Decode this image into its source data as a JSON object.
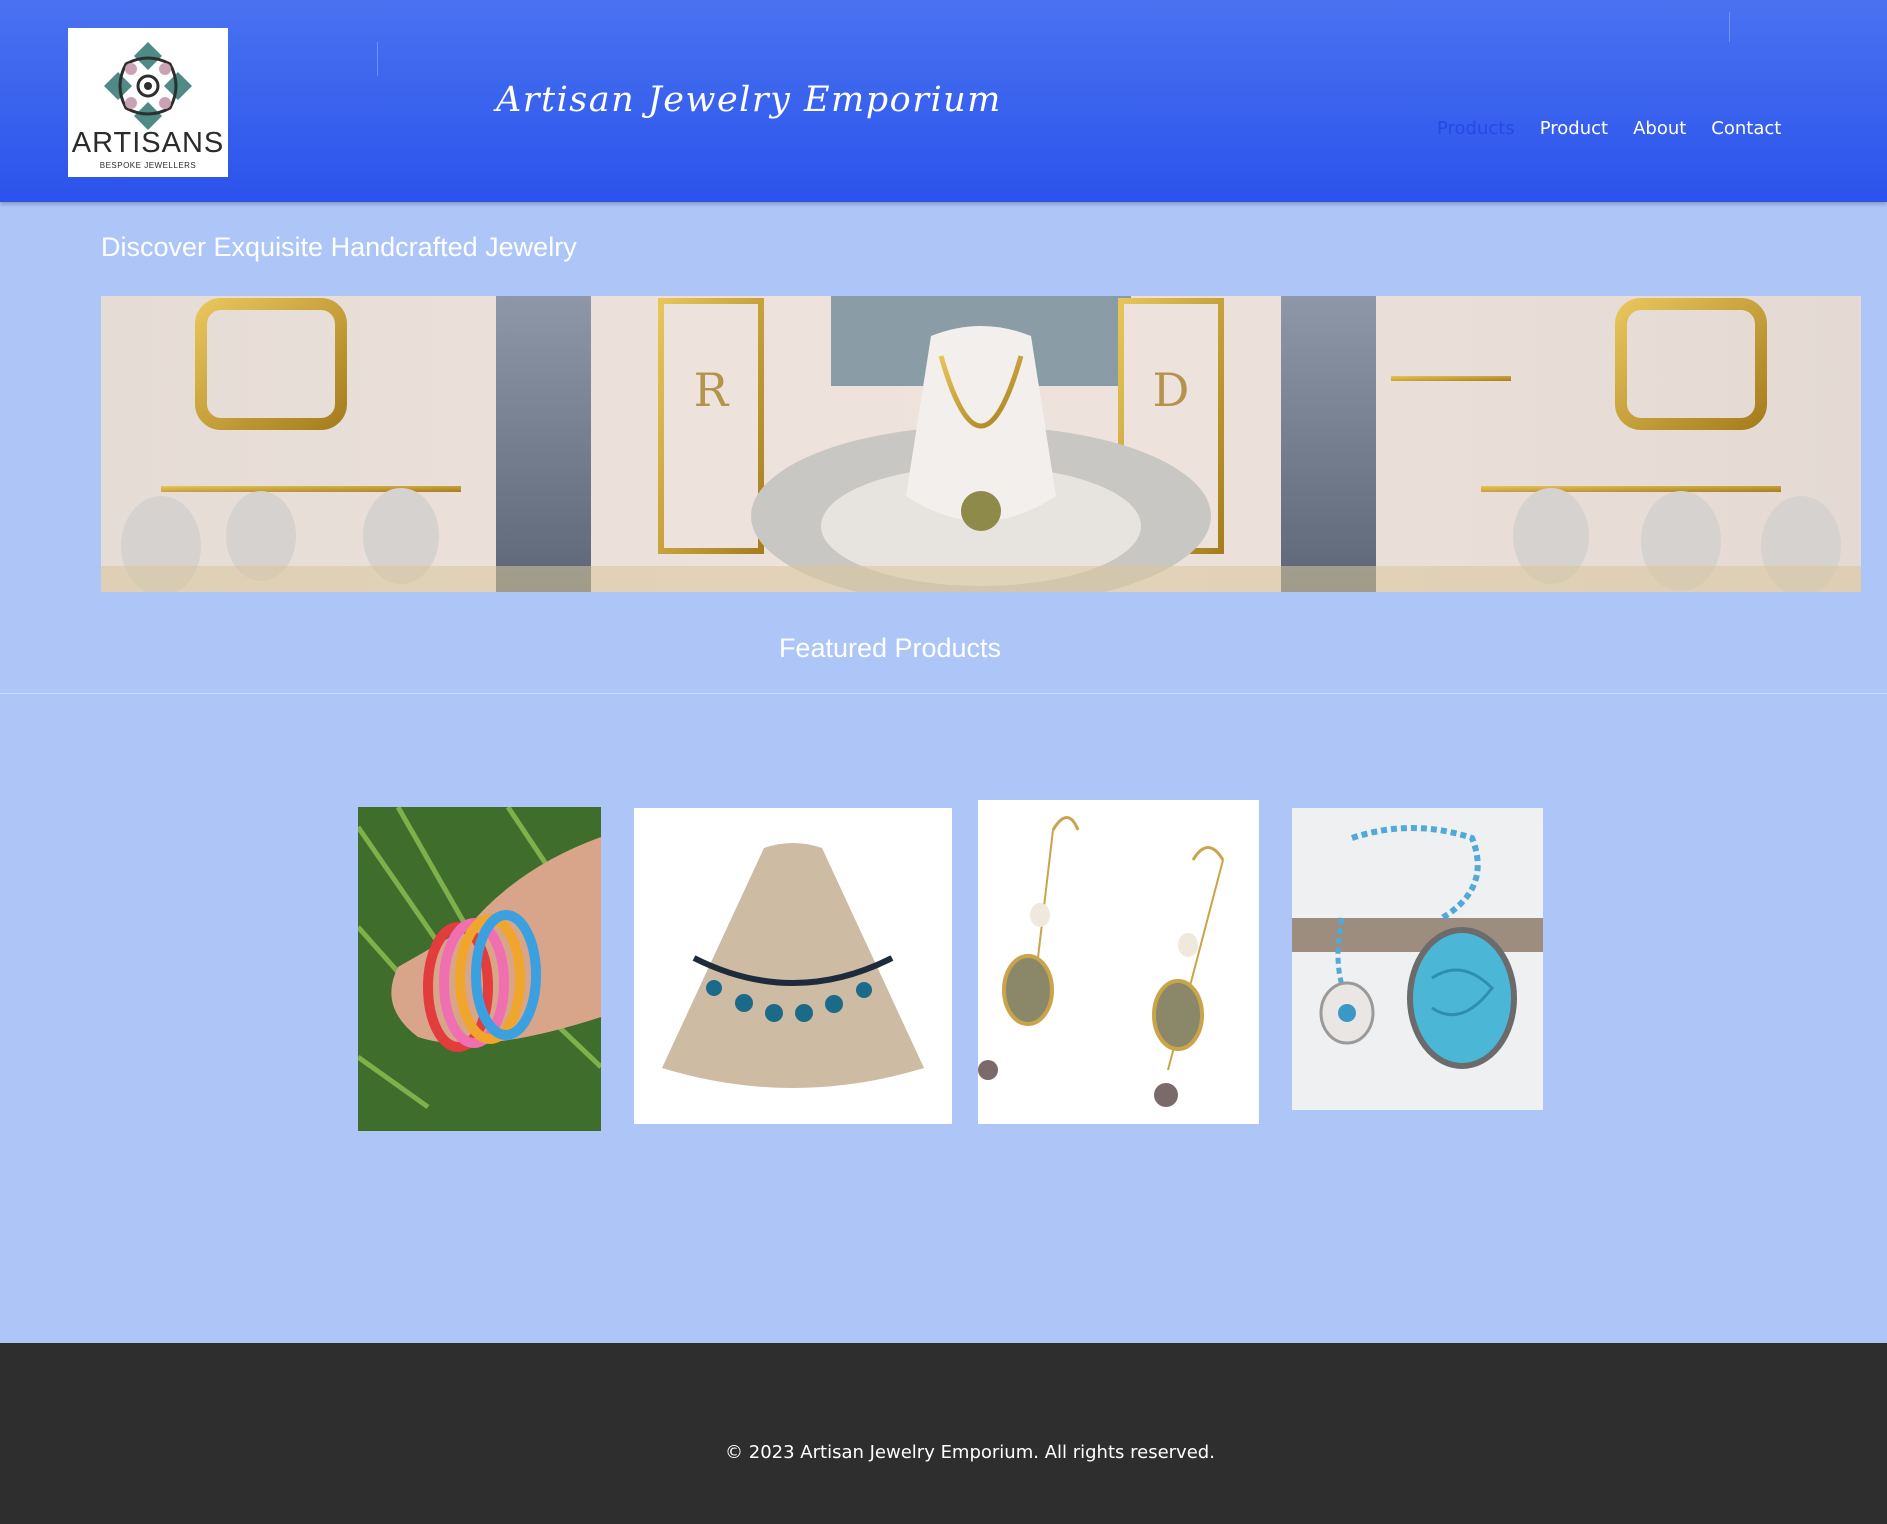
{
  "brand": {
    "logo_word": "ARTISANS",
    "logo_sub": "BESPOKE JEWELLERS",
    "site_title": "Artisan Jewelry Emporium"
  },
  "nav": {
    "items": [
      "Products",
      "Product",
      "About",
      "Contact"
    ],
    "active": "Products"
  },
  "hero": {
    "tagline": "Discover Exquisite Handcrafted Jewelry"
  },
  "featured": {
    "title": "Featured Products"
  },
  "footer": {
    "copyright": "© 2023 Artisan Jewelry Emporium. All rights reserved."
  },
  "colors": {
    "header": "#3a63ee",
    "page_bg": "#adc6f7",
    "footer_bg": "#2e2e2e",
    "nav_active": "#2449e6"
  }
}
